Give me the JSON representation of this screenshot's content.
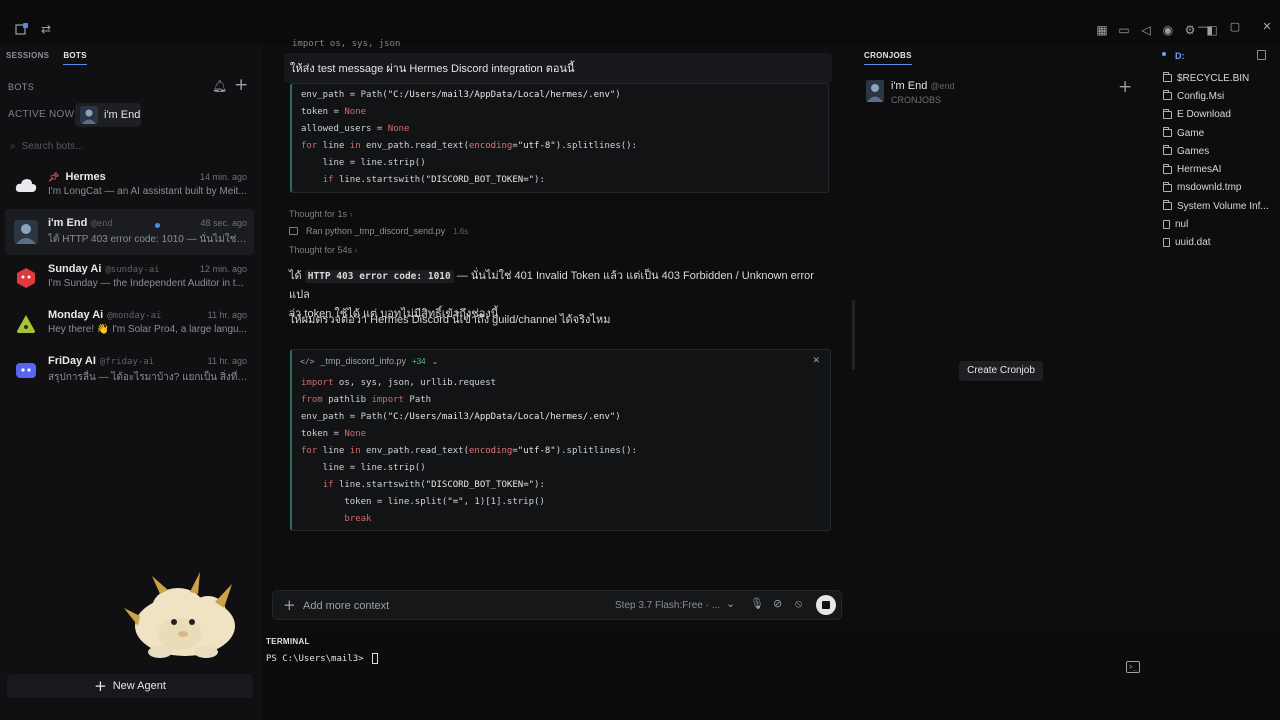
{
  "titlebar": {
    "badge": "2"
  },
  "sidebar": {
    "tabs": [
      "SESSIONS",
      "BOTS"
    ],
    "section_title": "BOTS",
    "active_now_label": "ACTIVE NOW",
    "active_now_name": "i'm End",
    "search_placeholder": "Search bots...",
    "bots": [
      {
        "name": "Hermes",
        "handle": "",
        "time": "14 min. ago",
        "preview": "I'm LongCat — an AI assistant built by Meit...",
        "color": "#e8eaed"
      },
      {
        "name": "i'm End",
        "handle": "@end",
        "time": "48 sec. ago",
        "preview": "ได้ HTTP 403 error code: 1010 — นั่นไม่ใช่ 4...",
        "color": "#3a4a5c"
      },
      {
        "name": "Sunday Ai",
        "handle": "@sunday-ai",
        "time": "12 min. ago",
        "preview": "I'm Sunday — the Independent Auditor in t...",
        "color": "#e0393e"
      },
      {
        "name": "Monday Ai",
        "handle": "@monday-ai",
        "time": "11 hr. ago",
        "preview": "Hey there! 👋 I'm Solar Pro4, a large langu...",
        "color": "#a6c43a"
      },
      {
        "name": "FriDay AI",
        "handle": "@friday-ai",
        "time": "11 hr. ago",
        "preview": "สรุปการลื่น — ได้อะไรมาบ้าง? แยกเป็น สิ่งที่สู...",
        "color": "#5865f2"
      }
    ],
    "new_agent_label": "New Agent"
  },
  "chat": {
    "top_code_fragment": "import os, sys, json",
    "user_message": "ให้ส่ง test message ผ่าน Hermes Discord integration ตอนนี้",
    "code1": [
      "env_path = Path(\"C:/Users/mail3/AppData/Local/hermes/.env\")",
      "token = None",
      "allowed_users = None",
      "for line in env_path.read_text(encoding=\"utf-8\").splitlines():",
      "    line = line.strip()",
      "    if line.startswith(\"DISCORD_BOT_TOKEN=\"):"
    ],
    "thought1": "Thought for 1s",
    "ran_cmd": "Ran python _tmp_discord_send.py",
    "ran_time": "1.6s",
    "thought2": "Thought for 54s",
    "para1_a": "ได้ ",
    "para1_code": "HTTP 403 error code: 1010",
    "para1_b": " — นั่นไม่ใช่ 401 Invalid Token แล้ว แต่เป็น 403 Forbidden / Unknown error แปล",
    "para1_c": "ว่า token ใช้ได้ แต่ บอทไม่มีสิทธิ์เข้าถึงช่องนี้",
    "para2": "ให้ผมตรวจต่อว่า Hermes Discord นี้เข้าถึง guild/channel ได้จริงไหม",
    "file_name": "_tmp_discord_info.py",
    "file_added": "+34",
    "code2": [
      "import os, sys, json, urllib.request",
      "from pathlib import Path",
      "env_path = Path(\"C:/Users/mail3/AppData/Local/hermes/.env\")",
      "token = None",
      "for line in env_path.read_text(encoding=\"utf-8\").splitlines():",
      "    line = line.strip()",
      "    if line.startswith(\"DISCORD_BOT_TOKEN=\"):",
      "        token = line.split(\"=\", 1)[1].strip()",
      "        break"
    ],
    "input_placeholder": "Add more context",
    "model_label": "Step 3.7 Flash:Free · ..."
  },
  "terminal": {
    "label": "TERMINAL",
    "prompt": "PS C:\\Users\\mail3> "
  },
  "cron": {
    "tab": "CRONJOBS",
    "job_name": "i'm End",
    "job_handle": "@end",
    "job_sub": "CRONJOBS",
    "create_label": "Create Cronjob"
  },
  "explorer": {
    "drive": "D:",
    "files": [
      {
        "name": "$RECYCLE.BIN",
        "type": "folder"
      },
      {
        "name": "Config.Msi",
        "type": "folder"
      },
      {
        "name": "E Download",
        "type": "folder"
      },
      {
        "name": "Game",
        "type": "folder"
      },
      {
        "name": "Games",
        "type": "folder"
      },
      {
        "name": "HermesAI",
        "type": "folder"
      },
      {
        "name": "msdownld.tmp",
        "type": "folder"
      },
      {
        "name": "System Volume Inf...",
        "type": "folder"
      },
      {
        "name": "nul",
        "type": "file"
      },
      {
        "name": "uuid.dat",
        "type": "file"
      }
    ]
  },
  "colors": {
    "accent": "#5b8def",
    "code_border": "#2f6a5c",
    "keyword": "#d06a6a"
  }
}
